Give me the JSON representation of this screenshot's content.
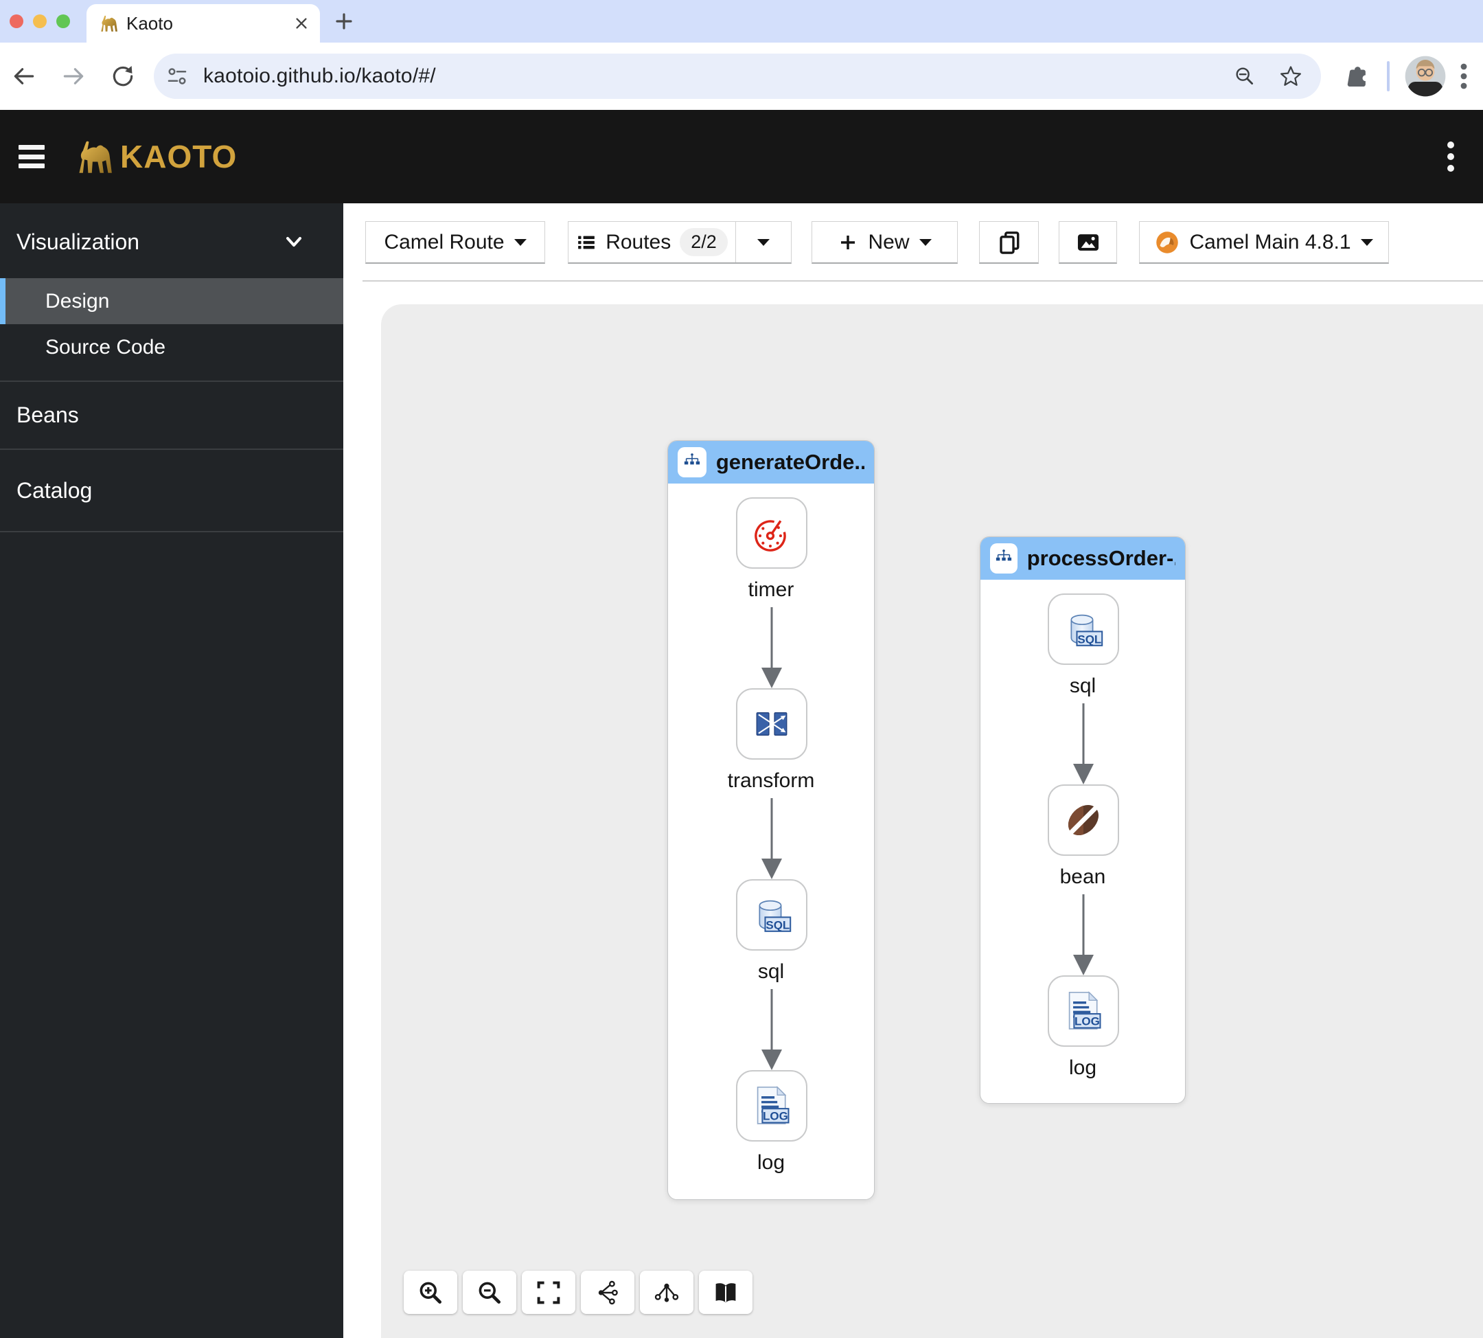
{
  "browser": {
    "tab_title": "Kaoto",
    "url": "kaotoio.github.io/kaoto/#/"
  },
  "app": {
    "brand": "KAOTO"
  },
  "sidebar": {
    "visualization_label": "Visualization",
    "items": [
      {
        "label": "Design",
        "selected": true
      },
      {
        "label": "Source Code",
        "selected": false
      }
    ],
    "beans_label": "Beans",
    "catalog_label": "Catalog"
  },
  "toolbar": {
    "dsl_label": "Camel Route",
    "routes_label": "Routes",
    "routes_badge": "2/2",
    "new_label": "New",
    "runtime_label": "Camel Main 4.8.1"
  },
  "canvas": {
    "routes": [
      {
        "title": "generateOrde...",
        "steps": [
          {
            "icon": "timer-icon",
            "label": "timer"
          },
          {
            "icon": "transform-icon",
            "label": "transform"
          },
          {
            "icon": "sql-icon",
            "label": "sql"
          },
          {
            "icon": "log-icon",
            "label": "log"
          }
        ]
      },
      {
        "title": "processOrder-...",
        "steps": [
          {
            "icon": "sql-icon",
            "label": "sql"
          },
          {
            "icon": "bean-icon",
            "label": "bean"
          },
          {
            "icon": "log-icon",
            "label": "log"
          }
        ]
      }
    ],
    "icon_text": {
      "sql": "SQL",
      "log": "LOG"
    }
  },
  "controls": {
    "buttons": [
      "zoom-in",
      "zoom-out",
      "fit-to-screen",
      "horizontal-layout",
      "vertical-layout",
      "catalog"
    ]
  },
  "colors": {
    "route_header_blue": "#8ac1f6",
    "sidebar_selected": "#4f5255",
    "selected_accent": "#73bcf7",
    "brand_gold": "#d2a33d",
    "canvas_gray": "#ededed"
  }
}
